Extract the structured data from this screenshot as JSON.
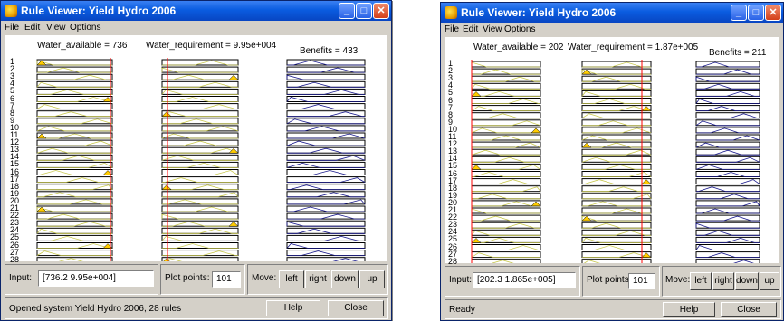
{
  "windows": [
    {
      "title": "Rule Viewer: Yield Hydro 2006",
      "menu": [
        "File",
        "Edit",
        "View",
        "Options"
      ],
      "headers": {
        "water_available": "Water_available = 736",
        "water_requirement": "Water_requirement = 9.95e+004",
        "benefits": "Benefits = 433"
      },
      "rule_count": 28,
      "input_label": "Input:",
      "input_value": "[736.2 9.95e+004]",
      "plot_points_label": "Plot points:",
      "plot_points_value": "101",
      "move_label": "Move:",
      "move_buttons": [
        "left",
        "right",
        "down",
        "up"
      ],
      "status": "Opened system Yield Hydro 2006, 28 rules",
      "help_label": "Help",
      "close_label": "Close"
    },
    {
      "title": "Rule Viewer: Yield Hydro 2006",
      "menu": [
        "File",
        "Edit",
        "View",
        "Options"
      ],
      "headers": {
        "water_available": "Water_available = 202",
        "water_requirement": "Water_requirement = 1.87e+005",
        "benefits": "Benefits = 211"
      },
      "rule_count": 28,
      "input_label": "Input:",
      "input_value": "[202.3 1.865e+005]",
      "plot_points_label": "Plot points:",
      "plot_points_value": "101",
      "move_label": "Move:",
      "move_buttons": [
        "left",
        "right",
        "down",
        "up"
      ],
      "status": "Ready",
      "help_label": "Help",
      "close_label": "Close"
    }
  ],
  "colors": {
    "titlebar": "#0a5ce0",
    "chrome": "#d4d0c8",
    "input_mf": "#c8c850",
    "input_fill": "#ffcc00",
    "output_mf": "#1a1a8c",
    "index_line": "#ff0000"
  }
}
